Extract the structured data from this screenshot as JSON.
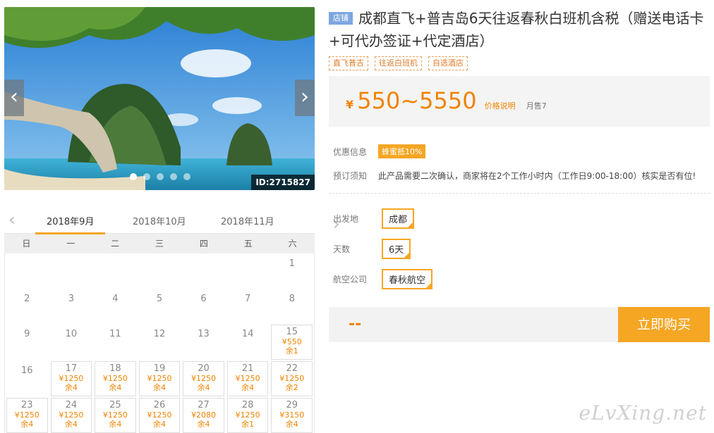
{
  "gallery": {
    "prev_icon": "‹",
    "next_icon": "›",
    "image_id": "ID:2715827",
    "slide_count": 5,
    "active_slide": 1
  },
  "calendar": {
    "prev_icon": "‹",
    "next_icon": "›",
    "months": [
      "2018年9月",
      "2018年10月",
      "2018年11月"
    ],
    "active_month": "2018年9月",
    "weekdays": [
      "日",
      "一",
      "二",
      "三",
      "四",
      "五",
      "六"
    ],
    "rows": [
      [
        {
          "day": ""
        },
        {
          "day": ""
        },
        {
          "day": ""
        },
        {
          "day": ""
        },
        {
          "day": ""
        },
        {
          "day": ""
        },
        {
          "day": "1"
        }
      ],
      [
        {
          "day": "2"
        },
        {
          "day": "3"
        },
        {
          "day": "4"
        },
        {
          "day": "5"
        },
        {
          "day": "6"
        },
        {
          "day": "7"
        },
        {
          "day": "8"
        }
      ],
      [
        {
          "day": "9"
        },
        {
          "day": "10"
        },
        {
          "day": "11"
        },
        {
          "day": "12"
        },
        {
          "day": "13"
        },
        {
          "day": "14"
        },
        {
          "day": "15",
          "price": "¥550",
          "left": "余1"
        }
      ],
      [
        {
          "day": "16"
        },
        {
          "day": "17",
          "price": "¥1250",
          "left": "余4"
        },
        {
          "day": "18",
          "price": "¥1250",
          "left": "余4"
        },
        {
          "day": "19",
          "price": "¥1250",
          "left": "余4"
        },
        {
          "day": "20",
          "price": "¥1250",
          "left": "余4"
        },
        {
          "day": "21",
          "price": "¥1250",
          "left": "余4"
        },
        {
          "day": "22",
          "price": "¥1250",
          "left": "余2"
        }
      ],
      [
        {
          "day": "23",
          "price": "¥1250",
          "left": "余4"
        },
        {
          "day": "24",
          "price": "¥1250",
          "left": "余4"
        },
        {
          "day": "25",
          "price": "¥1250",
          "left": "余4"
        },
        {
          "day": "26",
          "price": "¥1250",
          "left": "余4"
        },
        {
          "day": "27",
          "price": "¥2080",
          "left": "余4"
        },
        {
          "day": "28",
          "price": "¥1250",
          "left": "余1"
        },
        {
          "day": "29",
          "price": "¥3150",
          "left": "余4"
        }
      ]
    ]
  },
  "product": {
    "shop_badge": "店铺",
    "title": "成都直飞+普吉岛6天往返春秋白班机含税（赠送电话卡+可代办签证+代定酒店）",
    "tags": [
      "直飞普吉",
      "往返白班机",
      "自选酒店"
    ],
    "price_symbol": "¥",
    "price_range": "550~5550",
    "price_note": "价格说明",
    "monthly_sold": "月售7"
  },
  "info": {
    "promo_label": "优惠信息",
    "promo_badge": "蜂蜜抵10%",
    "notice_label": "预订须知",
    "notice_text": "此产品需要二次确认，商家将在2个工作小时内（工作日9:00-18:00）核实是否有位!"
  },
  "options": {
    "departure_label": "出发地",
    "departure_value": "成都",
    "days_label": "天数",
    "days_value": "6天",
    "airline_label": "航空公司",
    "airline_value": "春秋航空"
  },
  "buy": {
    "total": "--",
    "button_label": "立即购买"
  },
  "watermark": "eLvXing.net",
  "colors": {
    "accent": "#f5a623",
    "price": "#f08300",
    "badge": "#7da7e0"
  }
}
